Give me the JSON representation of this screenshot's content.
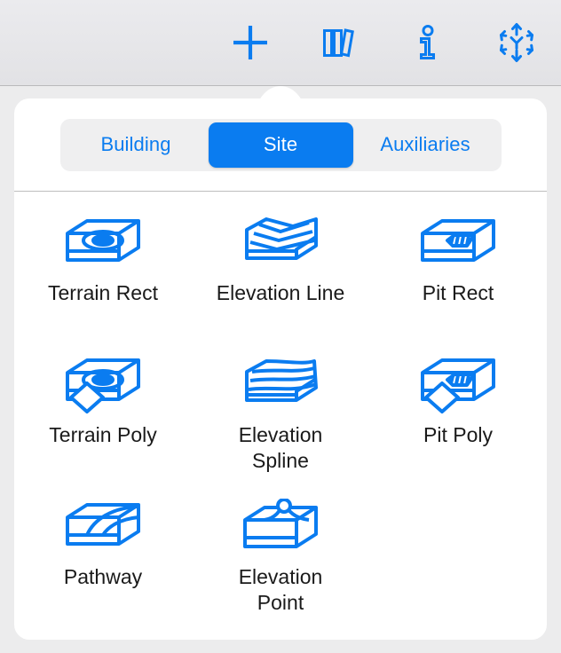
{
  "toolbar": {
    "buttons": [
      {
        "name": "add",
        "icon": "plus-icon",
        "label": "Add"
      },
      {
        "name": "library",
        "icon": "books-icon",
        "label": "Library"
      },
      {
        "name": "info",
        "icon": "info-icon",
        "label": "Info"
      },
      {
        "name": "orbit",
        "icon": "orbit-3d-icon",
        "label": "Orbit"
      }
    ]
  },
  "popover": {
    "segmented_control": {
      "selected": "Site",
      "options": [
        {
          "label": "Building"
        },
        {
          "label": "Site"
        },
        {
          "label": "Auxiliaries"
        }
      ]
    },
    "items": [
      {
        "label": "Terrain Rect",
        "icon": "terrain-rect-icon"
      },
      {
        "label": "Elevation Line",
        "icon": "elevation-line-icon"
      },
      {
        "label": "Pit Rect",
        "icon": "pit-rect-icon"
      },
      {
        "label": "Terrain Poly",
        "icon": "terrain-poly-icon"
      },
      {
        "label": "Elevation\nSpline",
        "icon": "elevation-spline-icon"
      },
      {
        "label": "Pit Poly",
        "icon": "pit-poly-icon"
      },
      {
        "label": "Pathway",
        "icon": "pathway-icon"
      },
      {
        "label": "Elevation Point",
        "icon": "elevation-point-icon"
      }
    ]
  },
  "colors": {
    "accent": "#0a7cf0",
    "toolbar_bg": "#e7e7ea",
    "popover_bg": "#ffffff",
    "segment_track": "#efeff0",
    "label_text": "#1a1a1a"
  }
}
